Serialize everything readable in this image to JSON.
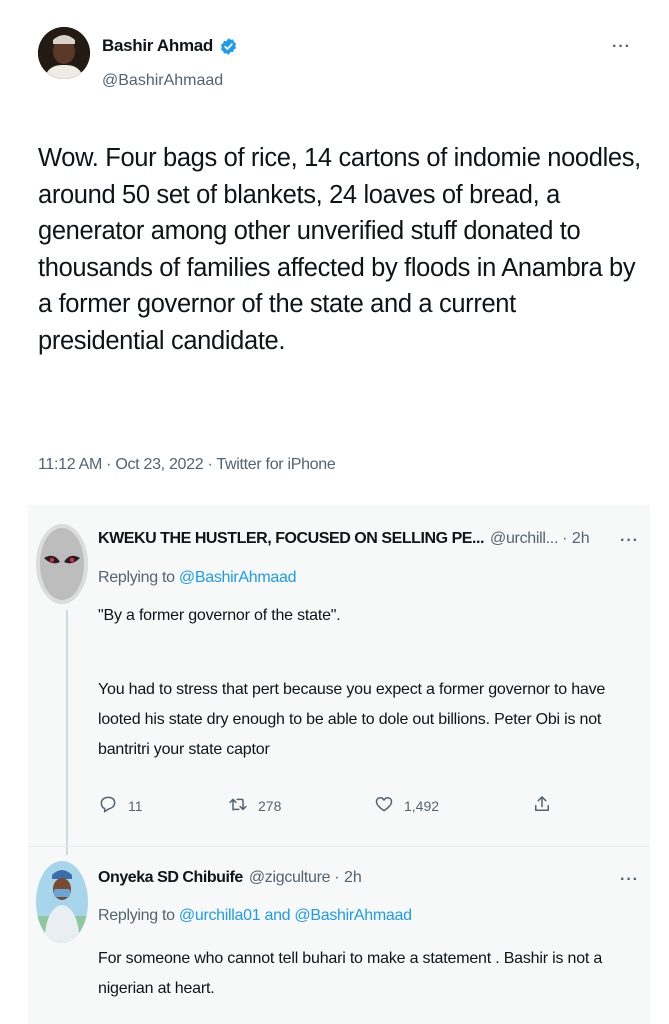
{
  "main_tweet": {
    "author_name": "Bashir Ahmad",
    "author_handle": "@BashirAhmaad",
    "text": "Wow. Four bags of rice, 14 cartons of indomie noodles, around 50 set of blankets, 24 loaves of bread, a generator among other unverified stuff donated to thousands of families affected by floods in Anambra by a former governor of the state and a current presidential candidate.",
    "meta": "11:12 AM · Oct 23, 2022 · Twitter for iPhone",
    "more_label": "···"
  },
  "reply1": {
    "author_name": "KWEKU THE HUSTLER, FOCUSED ON SELLING PE...",
    "author_handle": "@urchill...",
    "time": "· 2h",
    "replying_prefix": "Replying to ",
    "replying_to": "@BashirAhmaad",
    "text_p1": "\"By a former governor of the state\".",
    "text_p2": "You had to stress that pert because you expect a former governor to have looted his state dry enough to be able to dole out billions. Peter Obi is not bantritri your state captor",
    "replies": "11",
    "retweets": "278",
    "likes": "1,492",
    "more_label": "···"
  },
  "reply2": {
    "author_name": "Onyeka SD Chibuife",
    "author_handle": "@zigculture",
    "time": "· 2h",
    "replying_prefix": "Replying to ",
    "replying_to": "@urchilla01 and @BashirAhmaad",
    "text": "For someone who cannot tell buhari to make a statement . Bashir is not a nigerian at heart.",
    "more_label": "···"
  },
  "colors": {
    "accent": "#1d9bf0",
    "secondary_text": "#536471",
    "panel_bg": "#f7f9f9"
  }
}
